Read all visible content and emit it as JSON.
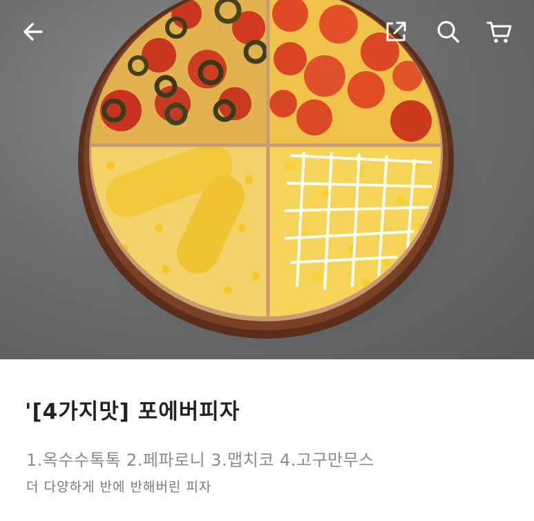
{
  "product": {
    "title": "'[4가지맛] 포에버피자",
    "options": "1.옥수수톡톡 2.페파로니 3.맵치코 4.고구만무스",
    "description": "더 다양하게 반에 반해버린 피자"
  },
  "icons": {
    "back": "arrow-left-icon",
    "share": "share-icon",
    "search": "search-icon",
    "cart": "cart-icon"
  },
  "colors": {
    "toolbar_icon": "#ffffff",
    "title_text": "#222222",
    "options_text": "#8a8a8a",
    "description_text": "#777777"
  }
}
